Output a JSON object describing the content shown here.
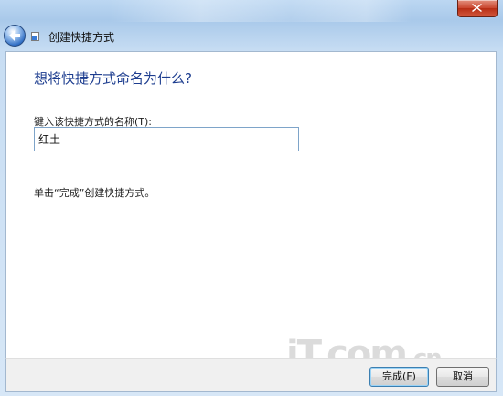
{
  "window": {
    "close_icon": "close-icon"
  },
  "nav": {
    "back_icon": "back-arrow-icon",
    "app_icon": "shortcut-icon",
    "title": "创建快捷方式"
  },
  "main": {
    "heading": "想将快捷方式命名为什么?",
    "name_label": "键入该快捷方式的名称(T):",
    "name_value": "红土",
    "instruction": "单击“完成”创建快捷方式。"
  },
  "footer": {
    "finish_label": "完成(F)",
    "cancel_label": "取消"
  },
  "watermark": {
    "main": "iT.com",
    "suffix": ".cn"
  },
  "colors": {
    "heading": "#1d3d8f",
    "close_button": "#c9452e",
    "accent": "#2d6cc4"
  }
}
